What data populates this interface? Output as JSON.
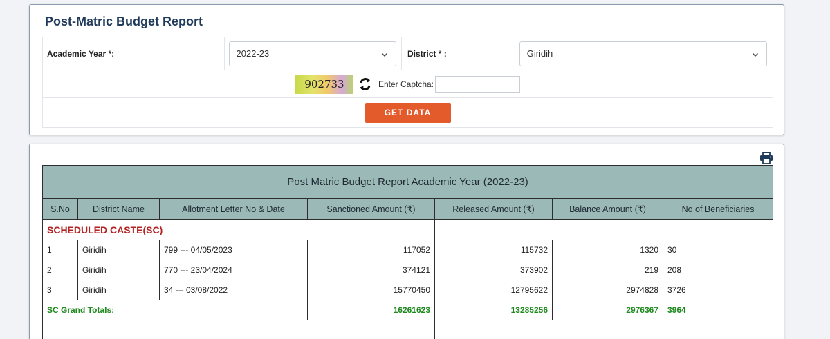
{
  "page": {
    "title": "Post-Matric Budget Report"
  },
  "filters": {
    "academic_year_label": "Academic Year *:",
    "academic_year_value": "2022-23",
    "district_label": "District * :",
    "district_value": "Giridih",
    "captcha_text": "902733",
    "captcha_label": "Enter Captcha:",
    "captcha_input_value": "",
    "get_data_label": "GET DATA"
  },
  "report": {
    "caption": "Post Matric Budget Report Academic Year (2022-23)",
    "columns": [
      "S.No",
      "District Name",
      "Allotment Letter No & Date",
      "Sanctioned Amount (₹)",
      "Released Amount (₹)",
      "Balance Amount (₹)",
      "No of Beneficiaries"
    ],
    "section_title": "SCHEDULED CASTE(SC)",
    "rows": [
      {
        "sno": "1",
        "district": "Giridih",
        "letter": "799 --- 04/05/2023",
        "sanctioned": "117052",
        "released": "115732",
        "balance": "1320",
        "beneficiaries": "30"
      },
      {
        "sno": "2",
        "district": "Giridih",
        "letter": "770 --- 23/04/2024",
        "sanctioned": "374121",
        "released": "373902",
        "balance": "219",
        "beneficiaries": "208"
      },
      {
        "sno": "3",
        "district": "Giridih",
        "letter": "34 --- 03/08/2022",
        "sanctioned": "15770450",
        "released": "12795622",
        "balance": "2974828",
        "beneficiaries": "3726"
      }
    ],
    "totals": {
      "label": "SC Grand Totals:",
      "sanctioned": "16261623",
      "released": "13285256",
      "balance": "2976367",
      "beneficiaries": "3964"
    }
  },
  "icons": {
    "refresh": "refresh-icon",
    "print": "print-icon",
    "chevron": "chevron-down-icon"
  },
  "colors": {
    "button": "#e35a2b",
    "table_header": "#9bb9b6",
    "section_title": "#b32222",
    "totals": "#1e8a1e",
    "title": "#1f3a5a"
  }
}
